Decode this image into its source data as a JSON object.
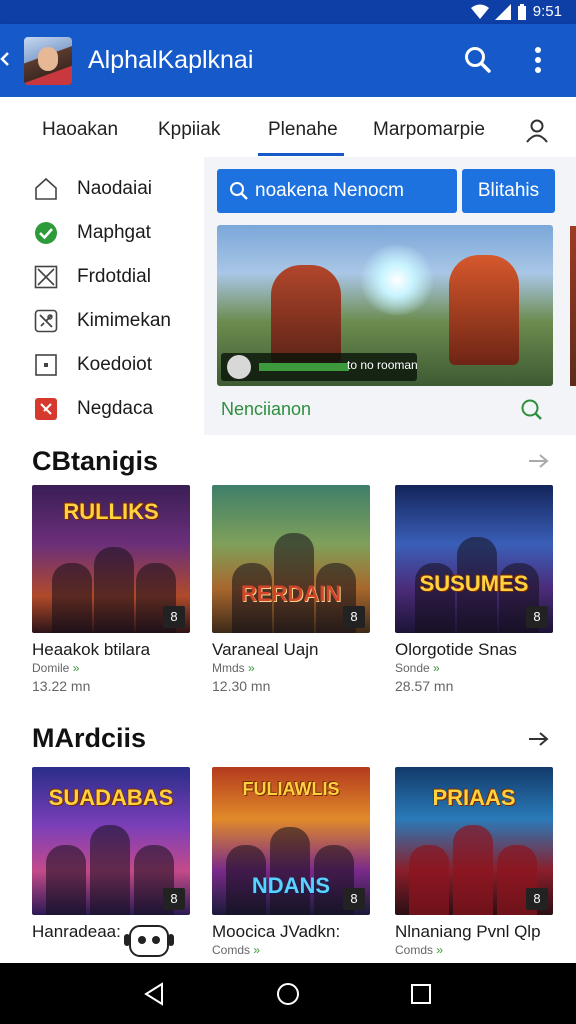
{
  "status_bar": {
    "time": "9:51"
  },
  "app_bar": {
    "title": "AlphalKaplknai"
  },
  "tabs": [
    {
      "label": "Haoakan"
    },
    {
      "label": "Kppiiak"
    },
    {
      "label": "Plenahe"
    },
    {
      "label": "Marpomarpie"
    }
  ],
  "drawer": {
    "items": [
      {
        "label": "Naodaiai",
        "icon": "home-icon"
      },
      {
        "label": "Maphgat",
        "icon": "check-circle-icon"
      },
      {
        "label": "Frdotdial",
        "icon": "x-box-icon"
      },
      {
        "label": "Kimimekan",
        "icon": "tools-icon"
      },
      {
        "label": "Koedoiot",
        "icon": "square-dot-icon"
      },
      {
        "label": "Negdaca",
        "icon": "red-app-icon"
      }
    ]
  },
  "search": {
    "value": "noakena Nenocm",
    "button_label": "Blitahis"
  },
  "hero": {
    "overlay_text": "to no rooman",
    "label": "Nenciianon"
  },
  "sections": [
    {
      "title": "CBtanigis",
      "cards": [
        {
          "name": "Heaakok btilara",
          "genre": "Domile",
          "size": "13.22 mn",
          "logo": "RULLIKS",
          "badge": "8"
        },
        {
          "name": "Varaneal Uajn",
          "genre": "Mmds",
          "size": "12.30 mn",
          "logo": "RERDAIN",
          "badge": "8"
        },
        {
          "name": "Olorgotide Snas",
          "genre": "Sonde",
          "size": "28.57 mn",
          "logo": "SUSUMES",
          "badge": "8"
        }
      ]
    },
    {
      "title": "MArdciis",
      "cards": [
        {
          "name": "Hanradeaa:",
          "genre": "",
          "size": "",
          "logo": "SUADABAS",
          "badge": "8"
        },
        {
          "name": "Moocica JVadkn:",
          "genre": "Comds",
          "size": "",
          "logo": "NDANS",
          "badge": "8"
        },
        {
          "name": "Nlnaniang Pvnl Qlp",
          "genre": "Comds",
          "size": "",
          "logo": "PRIAAS",
          "badge": "8"
        }
      ]
    }
  ],
  "colors": {
    "app_bar": "#1659c9",
    "status_bar": "#0d3fa6",
    "accent": "#1e72e0",
    "green": "#2d8f3e"
  }
}
